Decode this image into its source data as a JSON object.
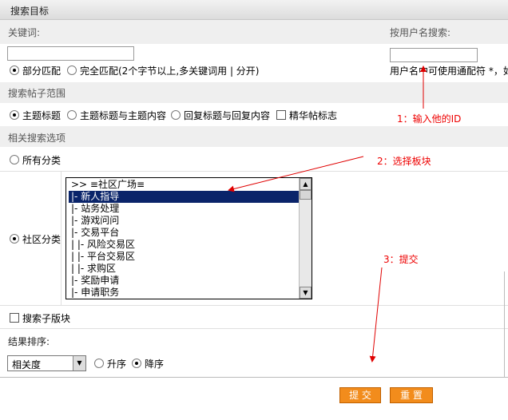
{
  "header": {
    "title": "搜索目标"
  },
  "keyword": {
    "label": "关键词:",
    "value": "",
    "partial": "部分匹配",
    "exact": "完全匹配(2个字节以上,多关键词用 | 分开)"
  },
  "username": {
    "label": "按用户名搜索:",
    "value": "",
    "hint": "用户名中可使用通配符 *，如"
  },
  "scope": {
    "title": "搜索帖子范围",
    "opt1": "主题标题",
    "opt2": "主题标题与主题内容",
    "opt3": "回复标题与回复内容",
    "opt4": "精华帖标志"
  },
  "related": {
    "title": "相关搜索选项",
    "all": "所有分类",
    "community": "社区分类"
  },
  "forums": {
    "items": [
      ">> ≡社区广场≡",
      "|- 新人指导",
      "|- 站务处理",
      "|- 游戏问问",
      "|- 交易平台",
      "|  |- 风险交易区",
      "|  |- 平台交易区",
      "|  |- 求购区",
      "|- 奖励申请",
      "|- 申请职务"
    ],
    "selected_index": 1
  },
  "subforum": {
    "label": "搜索子版块"
  },
  "sort": {
    "label": "结果排序:",
    "select_value": "相关度",
    "asc": "升序",
    "desc": "降序"
  },
  "buttons": {
    "submit": "提 交",
    "reset": "重 置"
  },
  "annotations": {
    "a1": "1：输入他的ID",
    "a2": "2：选择板块",
    "a3": "3：提交"
  },
  "colors": {
    "annotation": "#e00000",
    "button": "#f28c1c",
    "selection": "#0a246a"
  }
}
